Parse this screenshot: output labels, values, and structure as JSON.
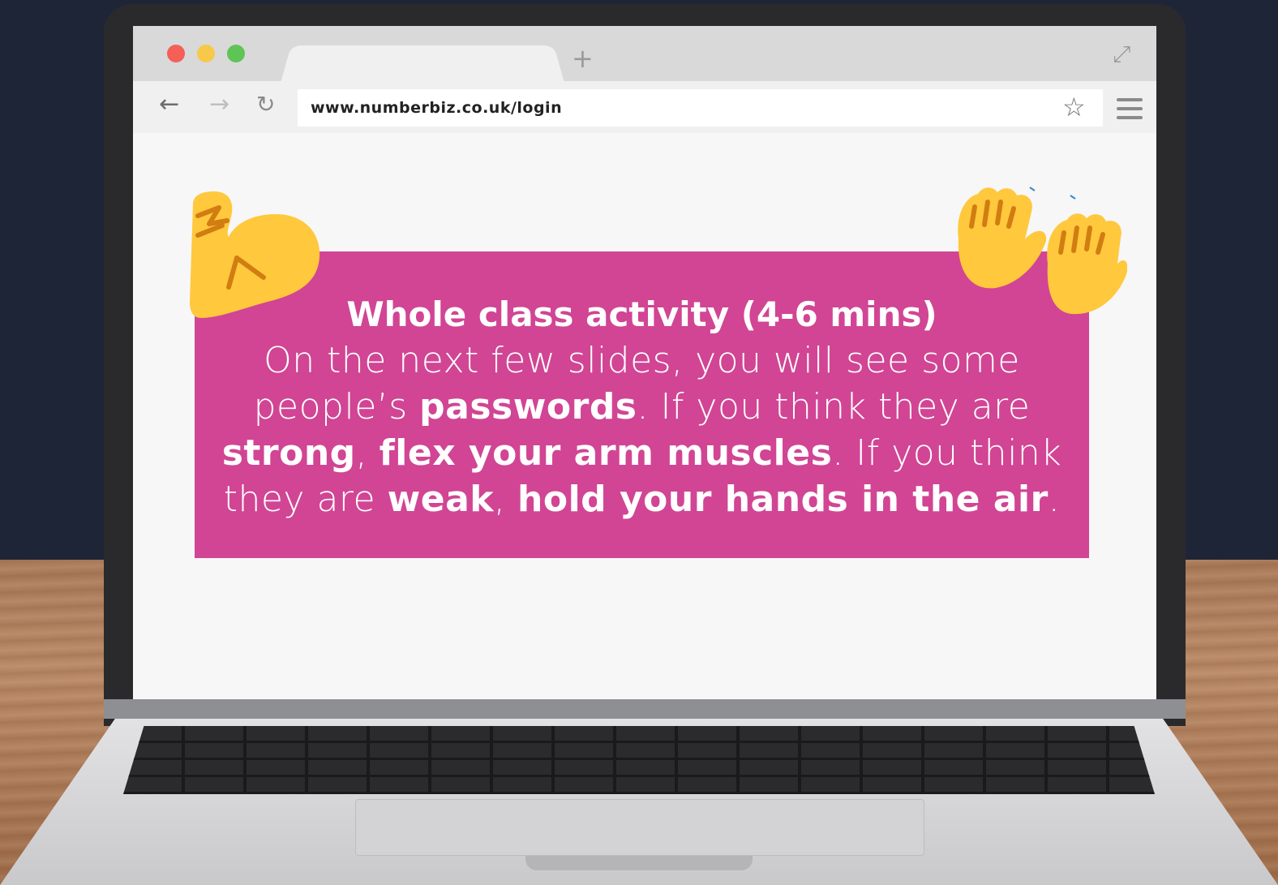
{
  "browser": {
    "new_tab_label": "+",
    "url": "www.numberbiz.co.uk/login"
  },
  "slide": {
    "title": "Whole class activity (4-6 mins)",
    "line1": "On the next few slides, you will see some",
    "line2_a": "people’s ",
    "line2_b": "passwords",
    "line2_c": ". If you think they are",
    "line3_a": "strong",
    "line3_b": ", ",
    "line3_c": "flex your arm muscles",
    "line3_d": ". If you think",
    "line4_a": "they are ",
    "line4_b": "weak",
    "line4_c": ", ",
    "line4_d": "hold your hands in the air",
    "line4_e": "."
  },
  "icons": {
    "flexed_biceps": "flexed-biceps-emoji",
    "raising_hands": "raising-hands-emoji"
  },
  "colors": {
    "card": "#d14594",
    "emoji": "#ffc83d",
    "emoji_line": "#d17d12"
  }
}
